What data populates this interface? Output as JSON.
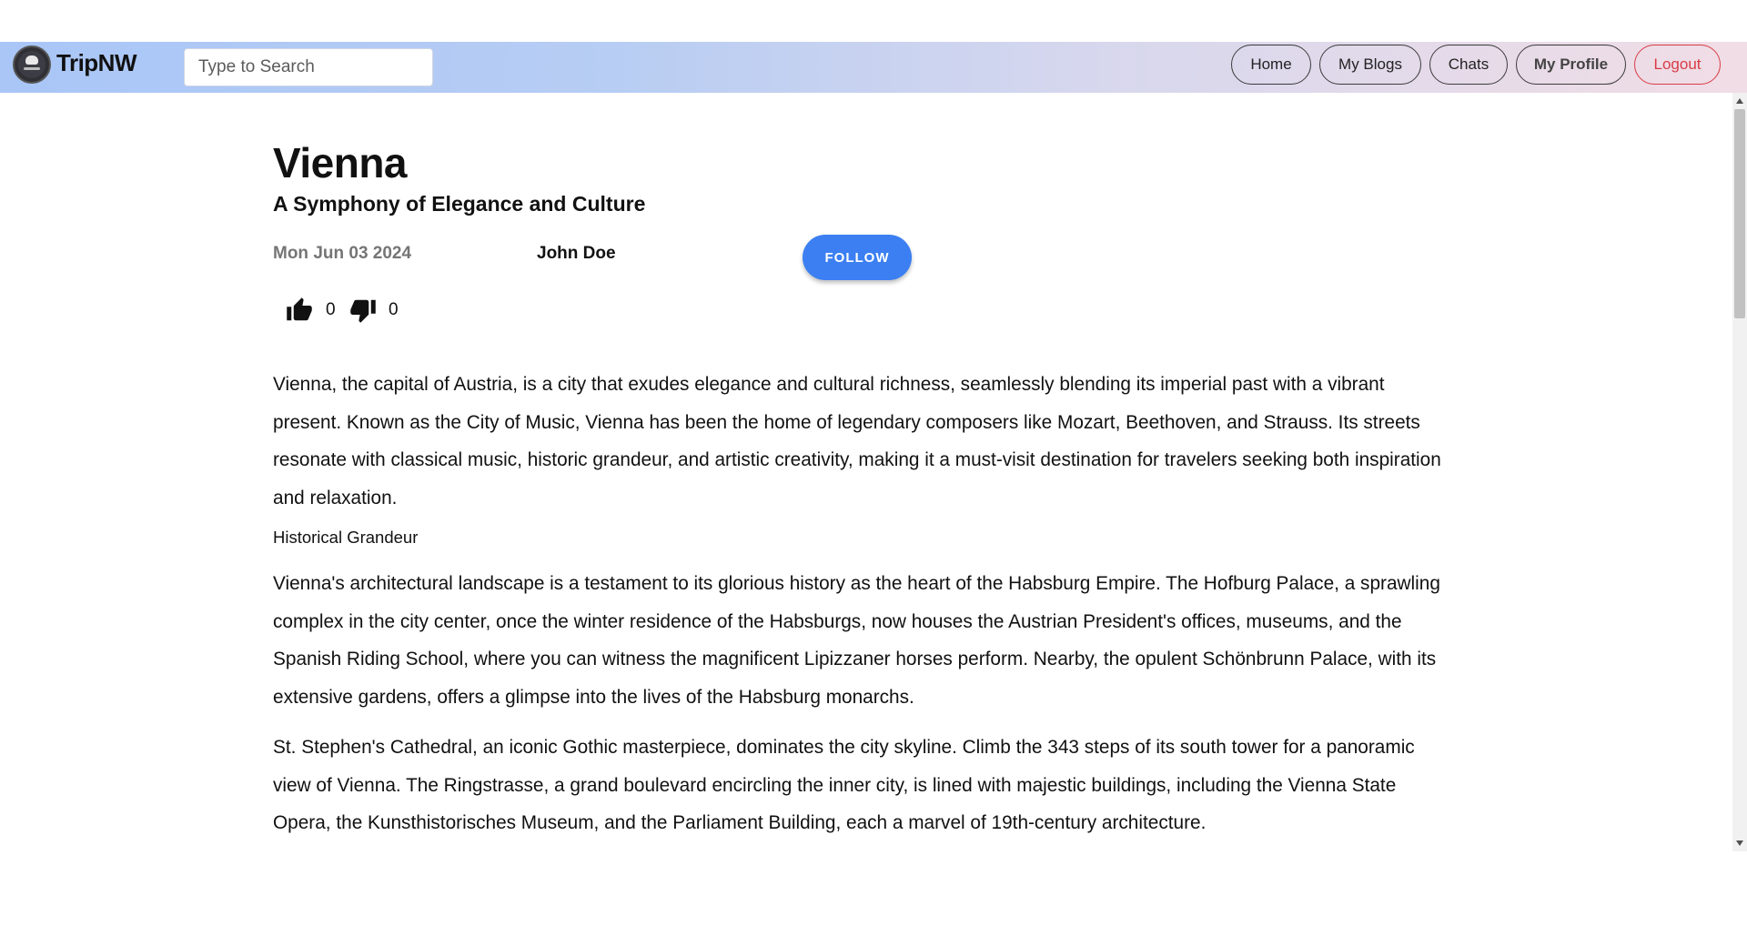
{
  "app": {
    "brand": "TripNW",
    "logo_icon": "tripnw-logo-icon"
  },
  "search": {
    "placeholder": "Type to Search",
    "value": ""
  },
  "nav": {
    "home": "Home",
    "my_blogs": "My Blogs",
    "chats": "Chats",
    "my_profile": "My Profile",
    "logout": "Logout"
  },
  "post": {
    "title": "Vienna",
    "subtitle": "A Symphony of Elegance and Culture",
    "date": "Mon Jun 03 2024",
    "author": "John Doe",
    "follow_label": "FOLLOW",
    "likes": "0",
    "dislikes": "0",
    "like_icon": "thumbs-up-icon",
    "dislike_icon": "thumbs-down-icon",
    "intro": "Vienna, the capital of Austria, is a city that exudes elegance and cultural richness, seamlessly blending its imperial past with a vibrant present. Known as the City of Music, Vienna has been the home of legendary composers like Mozart, Beethoven, and Strauss. Its streets resonate with classical music, historic grandeur, and artistic creativity, making it a must-visit destination for travelers seeking both inspiration and relaxation.",
    "section_heading": "Historical Grandeur",
    "para1": "Vienna's architectural landscape is a testament to its glorious history as the heart of the Habsburg Empire. The Hofburg Palace, a sprawling complex in the city center, once the winter residence of the Habsburgs, now houses the Austrian President's offices, museums, and the Spanish Riding School, where you can witness the magnificent Lipizzaner horses perform. Nearby, the opulent Schönbrunn Palace, with its extensive gardens, offers a glimpse into the lives of the Habsburg monarchs.",
    "para2": "St. Stephen's Cathedral, an iconic Gothic masterpiece, dominates the city skyline. Climb the 343 steps of its south tower for a panoramic view of Vienna. The Ringstrasse, a grand boulevard encircling the inner city, is lined with majestic buildings, including the Vienna State Opera, the Kunsthistorisches Museum, and the Parliament Building, each a marvel of 19th-century architecture."
  },
  "colors": {
    "navbar_gradient_start": "#a9c6f7",
    "navbar_gradient_end": "#f1dde5",
    "follow_button": "#3b7ff2",
    "logout": "#d83b45",
    "date_text": "#757575"
  }
}
